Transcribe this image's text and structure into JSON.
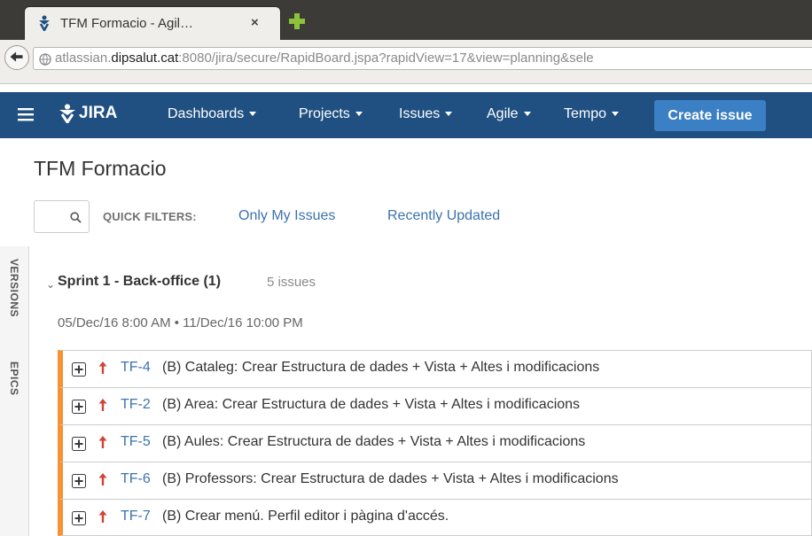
{
  "browser": {
    "tab_title": "TFM Formacio - Agil…",
    "tab_close": "×",
    "url_prefix": "atlassian.",
    "url_host": "dipsalut.cat",
    "url_rest": ":8080/jira/secure/RapidBoard.jspa?rapidView=17&view=planning&sele"
  },
  "header": {
    "logo_text": "JIRA",
    "nav": [
      "Dashboards",
      "Projects",
      "Issues",
      "Agile",
      "Tempo"
    ],
    "create_label": "Create issue",
    "bg_color": "#205081",
    "button_color": "#3b7fc4"
  },
  "page": {
    "title": "TFM Formacio",
    "quick_filters_label": "QUICK FILTERS:",
    "quick_filters": [
      "Only My Issues",
      "Recently Updated"
    ]
  },
  "sidebar": {
    "tabs": [
      "VERSIONS",
      "EPICS"
    ]
  },
  "sprint": {
    "name": "Sprint 1 - Back-office (1)",
    "issue_count": "5 issues",
    "dates": "05/Dec/16 8:00 AM • 11/Dec/16 10:00 PM",
    "accent_color": "#f79232",
    "issues": [
      {
        "key": "TF-4",
        "summary": "(B) Cataleg: Crear Estructura de dades + Vista + Altes i modificacions",
        "type_icon": "story-icon",
        "priority_icon": "priority-major-icon"
      },
      {
        "key": "TF-2",
        "summary": "(B) Area: Crear Estructura de dades + Vista + Altes i modificacions",
        "type_icon": "story-icon",
        "priority_icon": "priority-major-icon"
      },
      {
        "key": "TF-5",
        "summary": "(B) Aules: Crear Estructura de dades + Vista + Altes i modificacions",
        "type_icon": "story-icon",
        "priority_icon": "priority-major-icon"
      },
      {
        "key": "TF-6",
        "summary": "(B) Professors: Crear Estructura de dades + Vista + Altes i modificacions",
        "type_icon": "story-icon",
        "priority_icon": "priority-major-icon"
      },
      {
        "key": "TF-7",
        "summary": "(B) Crear menú. Perfil editor i pàgina d'accés.",
        "type_icon": "story-icon",
        "priority_icon": "priority-major-icon"
      }
    ]
  }
}
